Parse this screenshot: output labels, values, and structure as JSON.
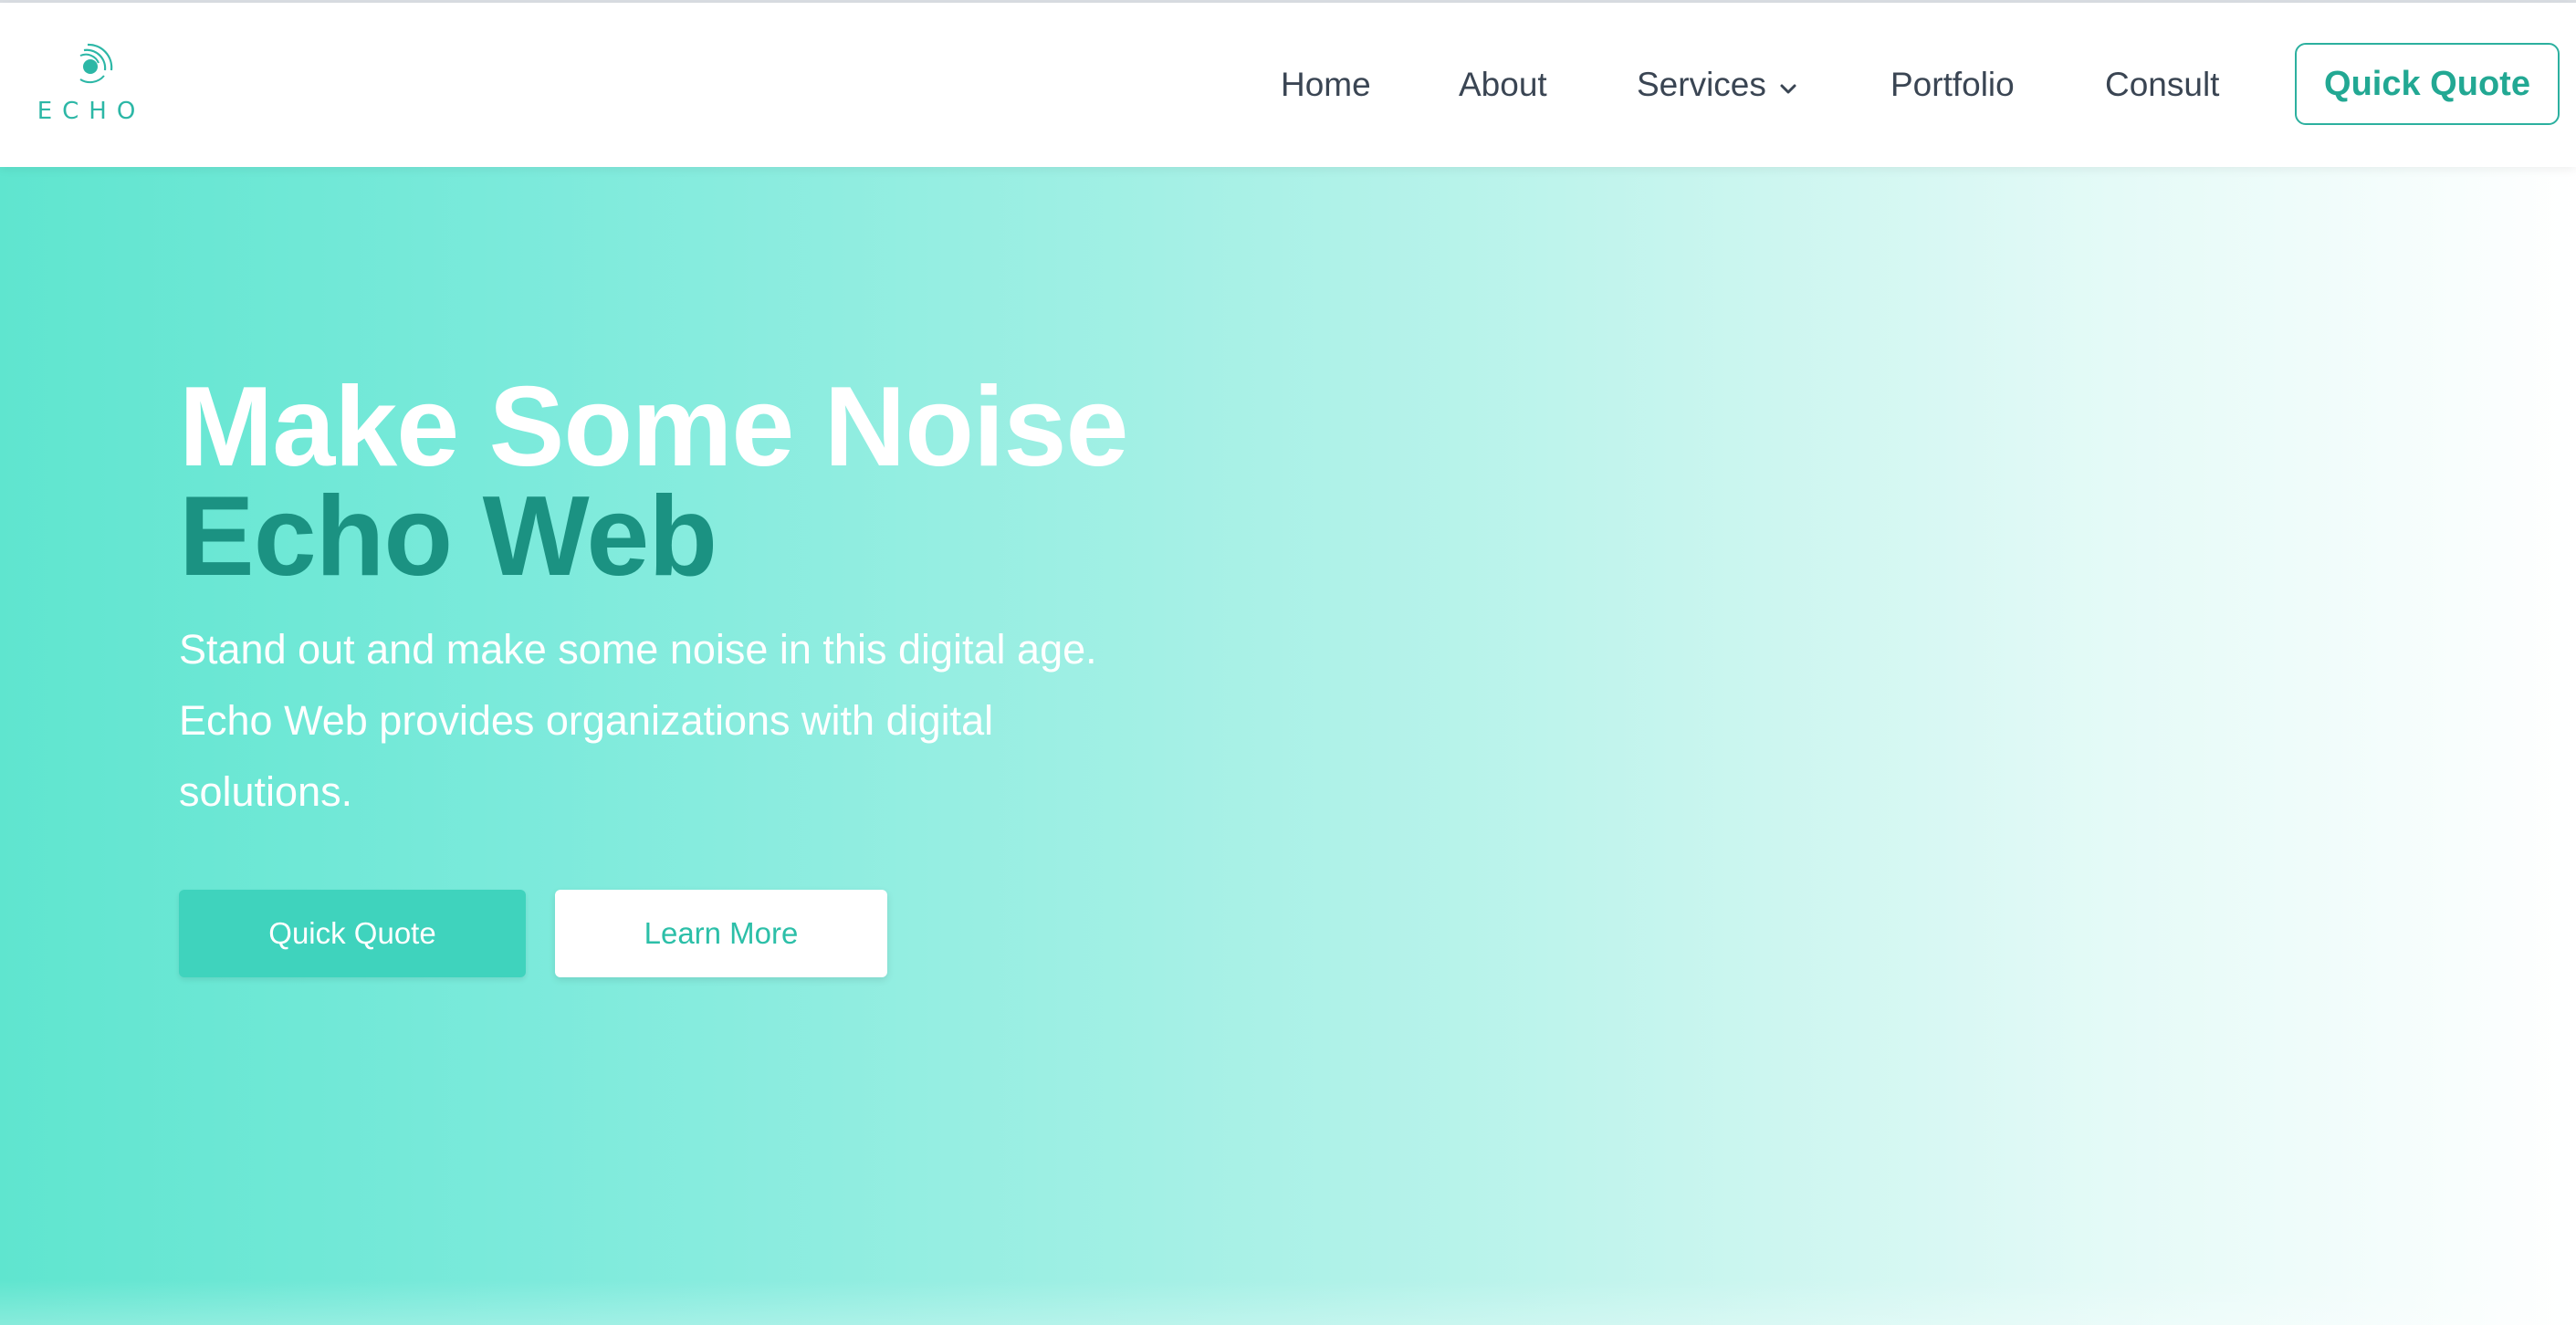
{
  "colors": {
    "accent": "#2cb09f",
    "hero_title_dark": "#1b9282",
    "nav_text": "#3a4553",
    "primary_button": "#3fd3bd",
    "hero_gradient_start": "#5fe5cf"
  },
  "header": {
    "logo": {
      "icon": "echo-swirl-icon",
      "text": "ECHO"
    },
    "nav": {
      "home": "Home",
      "about": "About",
      "services": "Services",
      "services_icon": "chevron-down-icon",
      "portfolio": "Portfolio",
      "consult": "Consult"
    },
    "cta_label": "Quick Quote"
  },
  "hero": {
    "title_line1": "Make Some Noise",
    "title_line2": "Echo Web",
    "description": "Stand out and make some noise in this digital age. Echo Web provides organizations with digital solutions.",
    "primary_button": "Quick Quote",
    "secondary_button": "Learn More"
  }
}
